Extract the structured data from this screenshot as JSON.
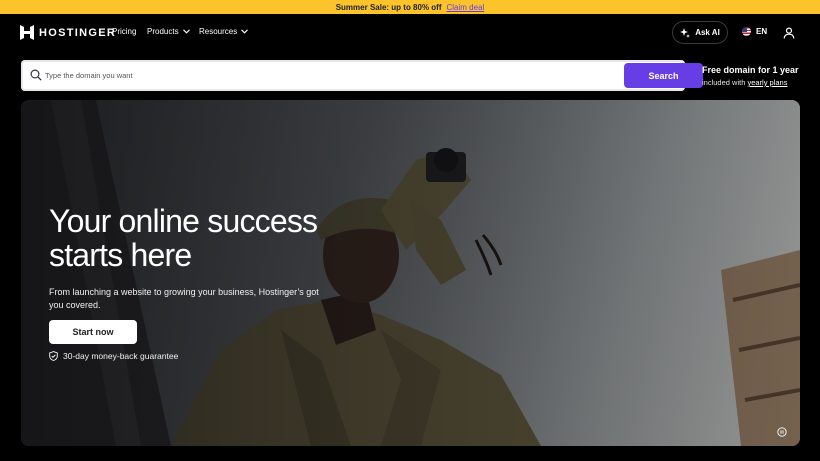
{
  "promo": {
    "text": "Summer Sale: up to 80% off",
    "link": "Claim deal"
  },
  "nav": {
    "brand": "HOSTINGER",
    "links": [
      {
        "label": "Pricing",
        "has_menu": false
      },
      {
        "label": "Products",
        "has_menu": true
      },
      {
        "label": "Resources",
        "has_menu": true
      }
    ],
    "ask_ai": "Ask AI",
    "language": "EN"
  },
  "search": {
    "placeholder": "Type the domain you want",
    "value": "",
    "button": "Search"
  },
  "free_domain": {
    "title": "Free domain for 1 year",
    "sub_prefix": "included with",
    "sub_link": "yearly plans"
  },
  "hero": {
    "title_line1": "Your online success",
    "title_line2": "starts here",
    "subtitle": "From launching a website to growing your business, Hostinger’s got you covered.",
    "cta": "Start now",
    "guarantee": "30-day money-back guarantee"
  },
  "colors": {
    "promo_bg": "#fcc42a",
    "accent": "#673de6",
    "page_bg": "#000000"
  },
  "icons": [
    "hostinger-logo-icon",
    "chevron-down-icon",
    "sparkle-icon",
    "us-flag-icon",
    "user-icon",
    "search-icon",
    "shield-check-icon",
    "pause-icon"
  ]
}
